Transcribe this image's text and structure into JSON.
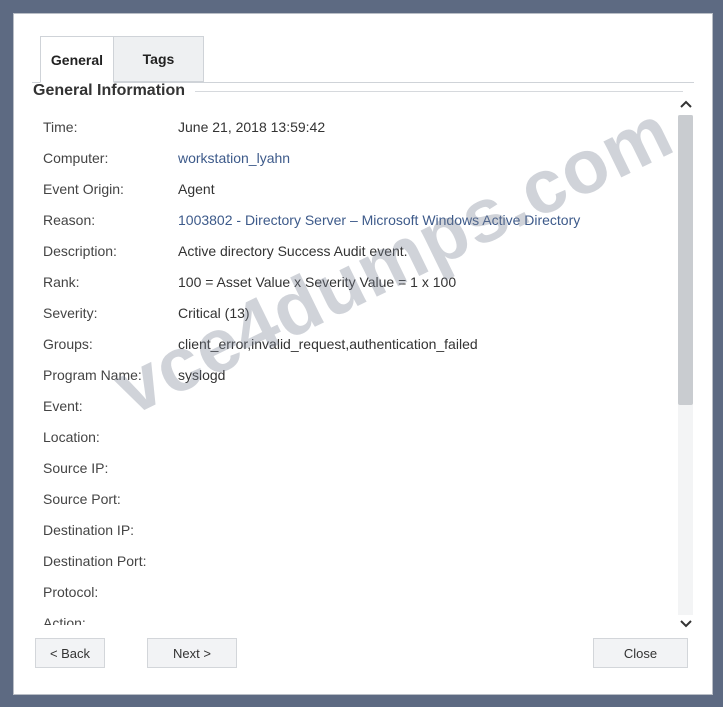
{
  "tabs": [
    {
      "label": "General",
      "active": true
    },
    {
      "label": "Tags",
      "active": false
    }
  ],
  "section_title": "General Information",
  "fields": [
    {
      "label": "Time:",
      "value": "June 21, 2018 13:59:42",
      "link": false
    },
    {
      "label": "Computer:",
      "value": "workstation_lyahn",
      "link": true
    },
    {
      "label": "Event Origin:",
      "value": "Agent",
      "link": false
    },
    {
      "label": "Reason:",
      "value": "1003802 - Directory Server – Microsoft Windows Active Directory",
      "link": true
    },
    {
      "label": "Description:",
      "value": "Active directory Success Audit event.",
      "link": false
    },
    {
      "label": "Rank:",
      "value": "100 = Asset Value x Severity Value = 1 x 100",
      "link": false
    },
    {
      "label": "Severity:",
      "value": "Critical (13)",
      "link": false
    },
    {
      "label": "Groups:",
      "value": "client_error,invalid_request,authentication_failed",
      "link": false
    },
    {
      "label": "Program Name:",
      "value": "syslogd",
      "link": false
    },
    {
      "label": "Event:",
      "value": "",
      "link": false
    },
    {
      "label": "Location:",
      "value": "",
      "link": false
    },
    {
      "label": "Source IP:",
      "value": "",
      "link": false
    },
    {
      "label": "Source Port:",
      "value": "",
      "link": false
    },
    {
      "label": "Destination IP:",
      "value": "",
      "link": false
    },
    {
      "label": "Destination Port:",
      "value": "",
      "link": false
    },
    {
      "label": "Protocol:",
      "value": "",
      "link": false
    },
    {
      "label": "Action:",
      "value": "",
      "link": false
    }
  ],
  "buttons": {
    "back": "< Back",
    "next": "Next >",
    "close": "Close"
  },
  "watermark": "vce4dumps.com",
  "icons": {
    "scroll_up": "chevron-up-icon",
    "scroll_down": "chevron-down-icon"
  },
  "colors": {
    "link": "#3d5a8a",
    "background": "#5d6a82"
  }
}
